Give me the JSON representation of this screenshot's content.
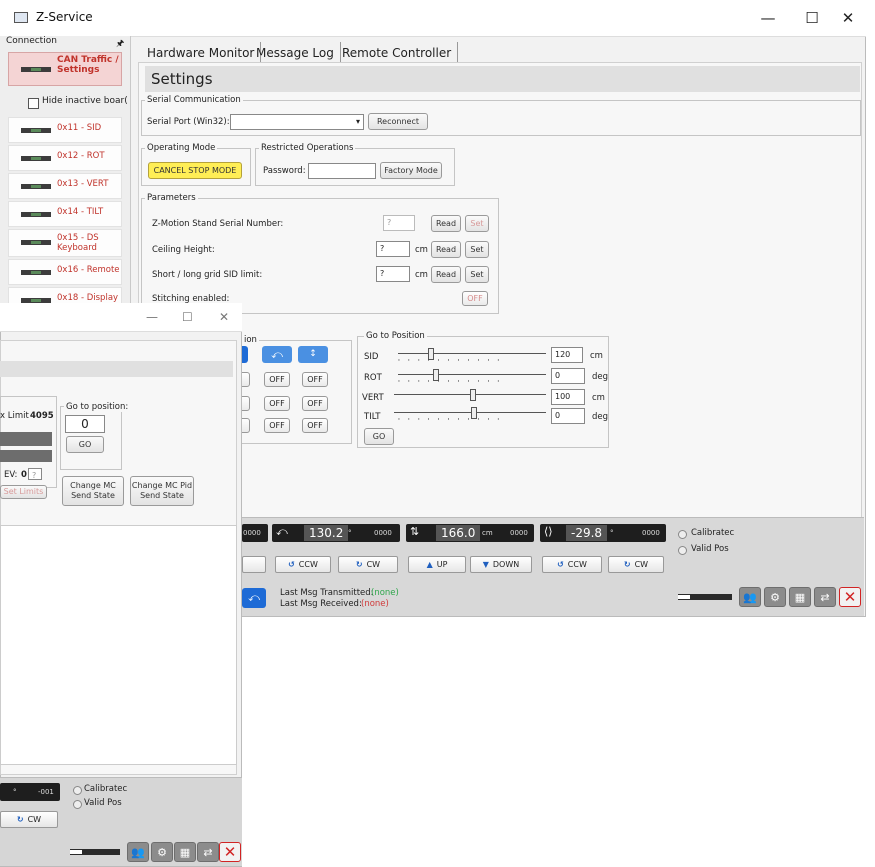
{
  "app": {
    "title": "Z-Service",
    "window_controls": {
      "minimize": "—",
      "maximize": "☐",
      "close": "✕"
    }
  },
  "sidebar": {
    "header": "Connection",
    "pin_icon": "pin-icon",
    "active_item": "CAN Traffic / Settings",
    "hide_inactive_label": "Hide inactive boar(",
    "items": [
      {
        "label": "0x11 - SID"
      },
      {
        "label": "0x12 - ROT"
      },
      {
        "label": "0x13 - VERT"
      },
      {
        "label": "0x14 - TILT"
      },
      {
        "label": "0x15 - DS Keyboard"
      },
      {
        "label": "0x16 - Remote"
      },
      {
        "label": "0x18 - Display"
      }
    ]
  },
  "tabs": [
    "Hardware Monitor",
    "Message Log",
    "Remote Controller"
  ],
  "settings": {
    "title": "Settings",
    "serial": {
      "legend": "Serial Communication",
      "port_label": "Serial Port (Win32):",
      "port_value": "",
      "reconnect": "Reconnect"
    },
    "operating_mode": {
      "legend": "Operating Mode",
      "cancel_stop": "CANCEL STOP MODE"
    },
    "restricted": {
      "legend": "Restricted Operations",
      "password_label": "Password:",
      "password_value": "",
      "factory_mode": "Factory Mode"
    },
    "parameters": {
      "legend": "Parameters",
      "rows": [
        {
          "label": "Z-Motion Stand Serial Number:",
          "value": "?",
          "unit": "",
          "read": "Read",
          "set": "Set"
        },
        {
          "label": "Ceiling Height:",
          "value": "?",
          "unit": "cm",
          "read": "Read",
          "set": "Set"
        },
        {
          "label": "Short / long grid SID limit:",
          "value": "?",
          "unit": "cm",
          "read": "Read",
          "set": "Set"
        }
      ],
      "stitching_label": "Stitching enabled:",
      "stitching_value": "OFF"
    },
    "position_legend_partial": "ion",
    "off_label": "OFF",
    "go_to_position": {
      "legend": "Go to Position",
      "rows": [
        {
          "label": "SID",
          "value": "120",
          "unit": "cm"
        },
        {
          "label": "ROT",
          "value": "0",
          "unit": "deg"
        },
        {
          "label": "VERT",
          "value": "100",
          "unit": "cm"
        },
        {
          "label": "TILT",
          "value": "0",
          "unit": "deg"
        }
      ],
      "go": "GO"
    }
  },
  "status": {
    "readouts": [
      {
        "partial": "0000"
      },
      {
        "value": "130.2",
        "unit": "°",
        "suffix": "0000"
      },
      {
        "value": "166.0",
        "unit": "cm",
        "suffix": "0000"
      },
      {
        "value": "-29.8",
        "unit": "°",
        "suffix": "0000"
      }
    ],
    "buttons": [
      "CCW",
      "CW",
      "UP",
      "DOWN",
      "CCW",
      "CW"
    ],
    "calibrated": "Calibratec",
    "valid_pos": "Valid Pos",
    "last_tx_label": "Last Msg Transmitted:",
    "last_tx_value": "(none)",
    "last_rx_label": "Last Msg Received:",
    "last_rx_value": "(none)"
  },
  "window2": {
    "controls": {
      "minimize": "—",
      "maximize": "☐",
      "close": "✕"
    },
    "limit_label": "x Limit",
    "limit_value": "4095",
    "go_to_label": "Go to position:",
    "go_to_value": "0",
    "go": "GO",
    "ev_label": "EV:",
    "ev_value": "0",
    "ev_input": "?",
    "set_limits": "Set Limits",
    "change_mc_send": "Change MC Send State",
    "change_mc_pid": "Change MC Pid Send State",
    "readout_suffix": "-001",
    "readout_unit": "°",
    "cw": "CW",
    "calibrated": "Calibratec",
    "valid_pos": "Valid Pos"
  }
}
